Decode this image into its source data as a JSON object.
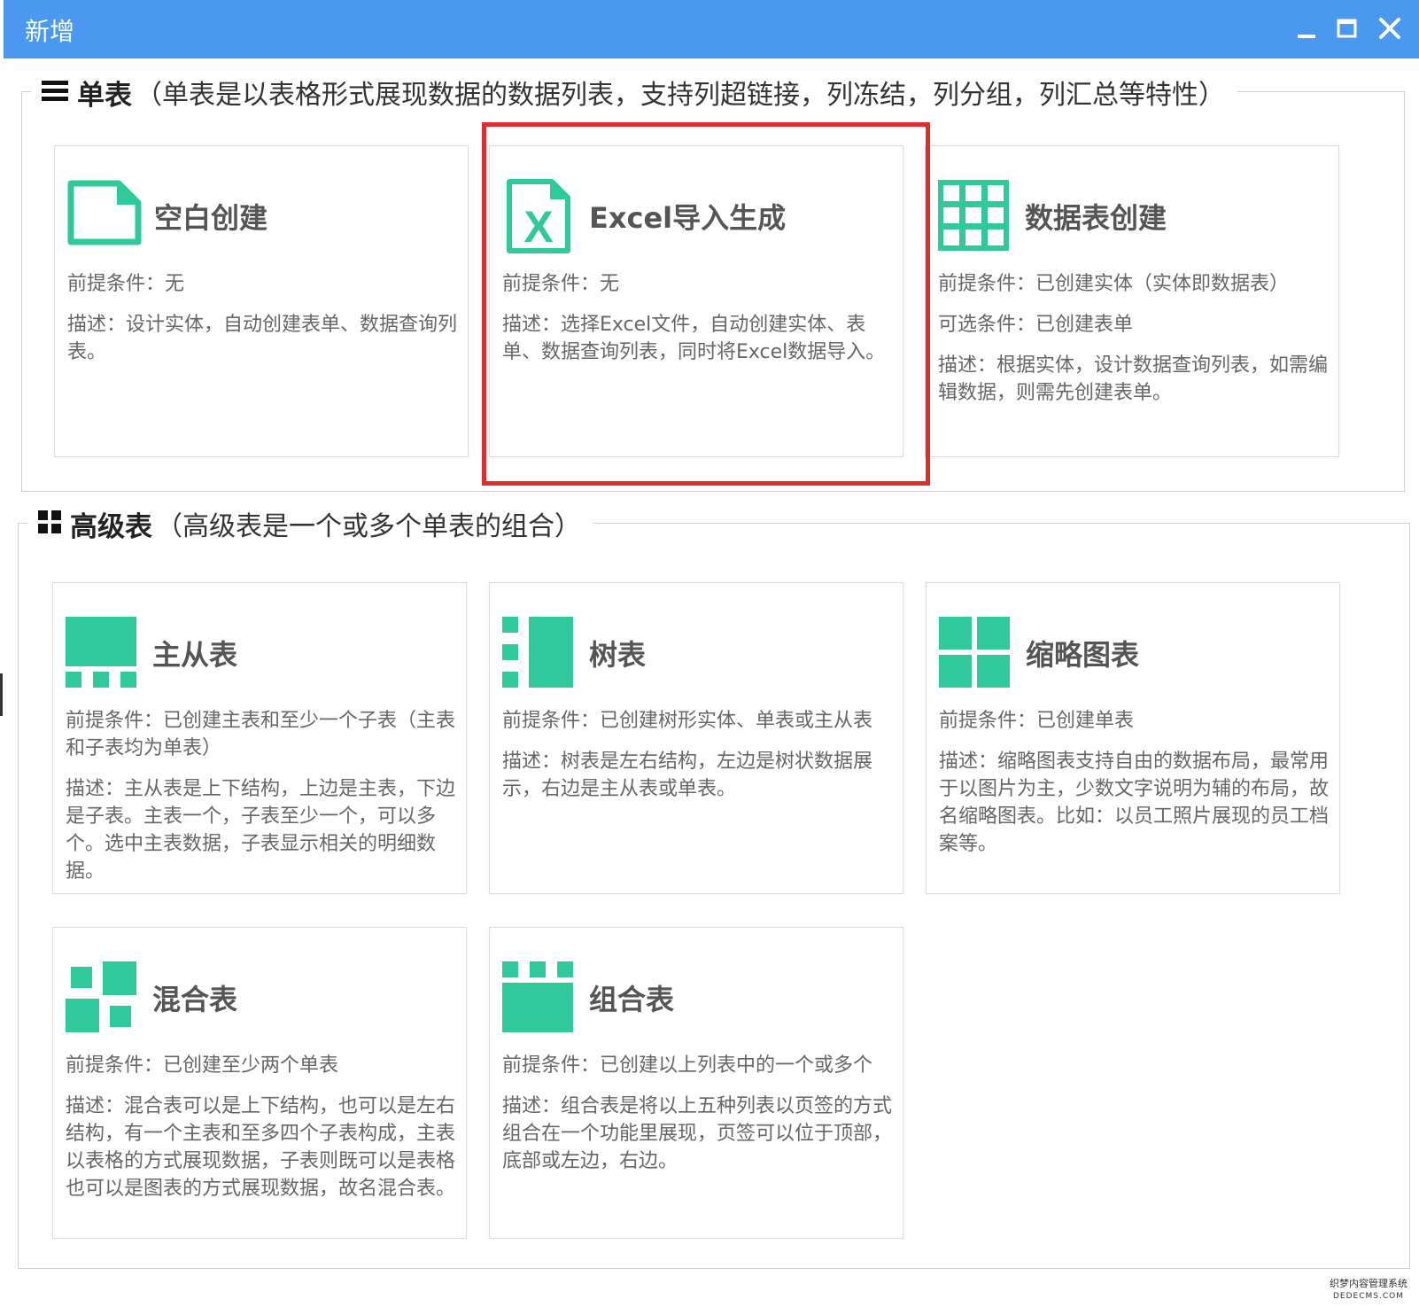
{
  "window": {
    "title": "新增",
    "controls": {
      "minimize": "minimize-icon",
      "maximize": "maximize-icon",
      "close": "close-icon"
    },
    "titlebar_color": "#4a98f0"
  },
  "sections": {
    "single": {
      "title": "单表",
      "desc": "（单表是以表格形式展现数据的数据列表，支持列超链接，列冻结，列分组，列汇总等特性）",
      "icon": "list-icon",
      "cards": [
        {
          "title": "空白创建",
          "icon": "blank-file-icon",
          "lines": [
            "前提条件：无",
            "描述：设计实体，自动创建表单、数据查询列表。"
          ]
        },
        {
          "title": "Excel导入生成",
          "icon": "excel-file-icon",
          "lines": [
            "前提条件：无",
            "描述：选择Excel文件，自动创建实体、表单、数据查询列表，同时将Excel数据导入。"
          ]
        },
        {
          "title": "数据表创建",
          "icon": "data-table-icon",
          "lines": [
            "前提条件：已创建实体（实体即数据表）",
            "可选条件：已创建表单",
            "描述：根据实体，设计数据查询列表，如需编辑数据，则需先创建表单。"
          ]
        }
      ]
    },
    "advanced": {
      "title": "高级表",
      "desc": "（高级表是一个或多个单表的组合）",
      "icon": "grid-icon",
      "cards": [
        {
          "title": "主从表",
          "icon": "master-detail-icon",
          "lines": [
            "前提条件：已创建主表和至少一个子表（主表和子表均为单表）",
            "描述：主从表是上下结构，上边是主表，下边是子表。主表一个，子表至少一个，可以多个。选中主表数据，子表显示相关的明细数据。"
          ]
        },
        {
          "title": "树表",
          "icon": "tree-table-icon",
          "lines": [
            "前提条件：已创建树形实体、单表或主从表",
            "描述：树表是左右结构，左边是树状数据展示，右边是主从表或单表。"
          ]
        },
        {
          "title": "缩略图表",
          "icon": "thumbnail-icon",
          "lines": [
            "前提条件：已创建单表",
            "描述：缩略图表支持自由的数据布局，最常用于以图片为主，少数文字说明为辅的布局，故名缩略图表。比如：以员工照片展现的员工档案等。"
          ]
        },
        {
          "title": "混合表",
          "icon": "mixed-table-icon",
          "lines": [
            "前提条件：已创建至少两个单表",
            "描述：混合表可以是上下结构，也可以是左右结构，有一个主表和至多四个子表构成，主表以表格的方式展现数据，子表则既可以是表格也可以是图表的方式展现数据，故名混合表。"
          ]
        },
        {
          "title": "组合表",
          "icon": "tabbed-combo-icon",
          "lines": [
            "前提条件：已创建以上列表中的一个或多个",
            "描述：组合表是将以上五种列表以页签的方式组合在一个功能里展现，页签可以位于顶部，底部或左边，右边。"
          ]
        }
      ]
    }
  },
  "colors": {
    "accent": "#2fc99b",
    "highlight": "#e02c2c"
  },
  "watermark": {
    "line1": "织梦内容管理系统",
    "line2": "DEDECMS.COM"
  }
}
